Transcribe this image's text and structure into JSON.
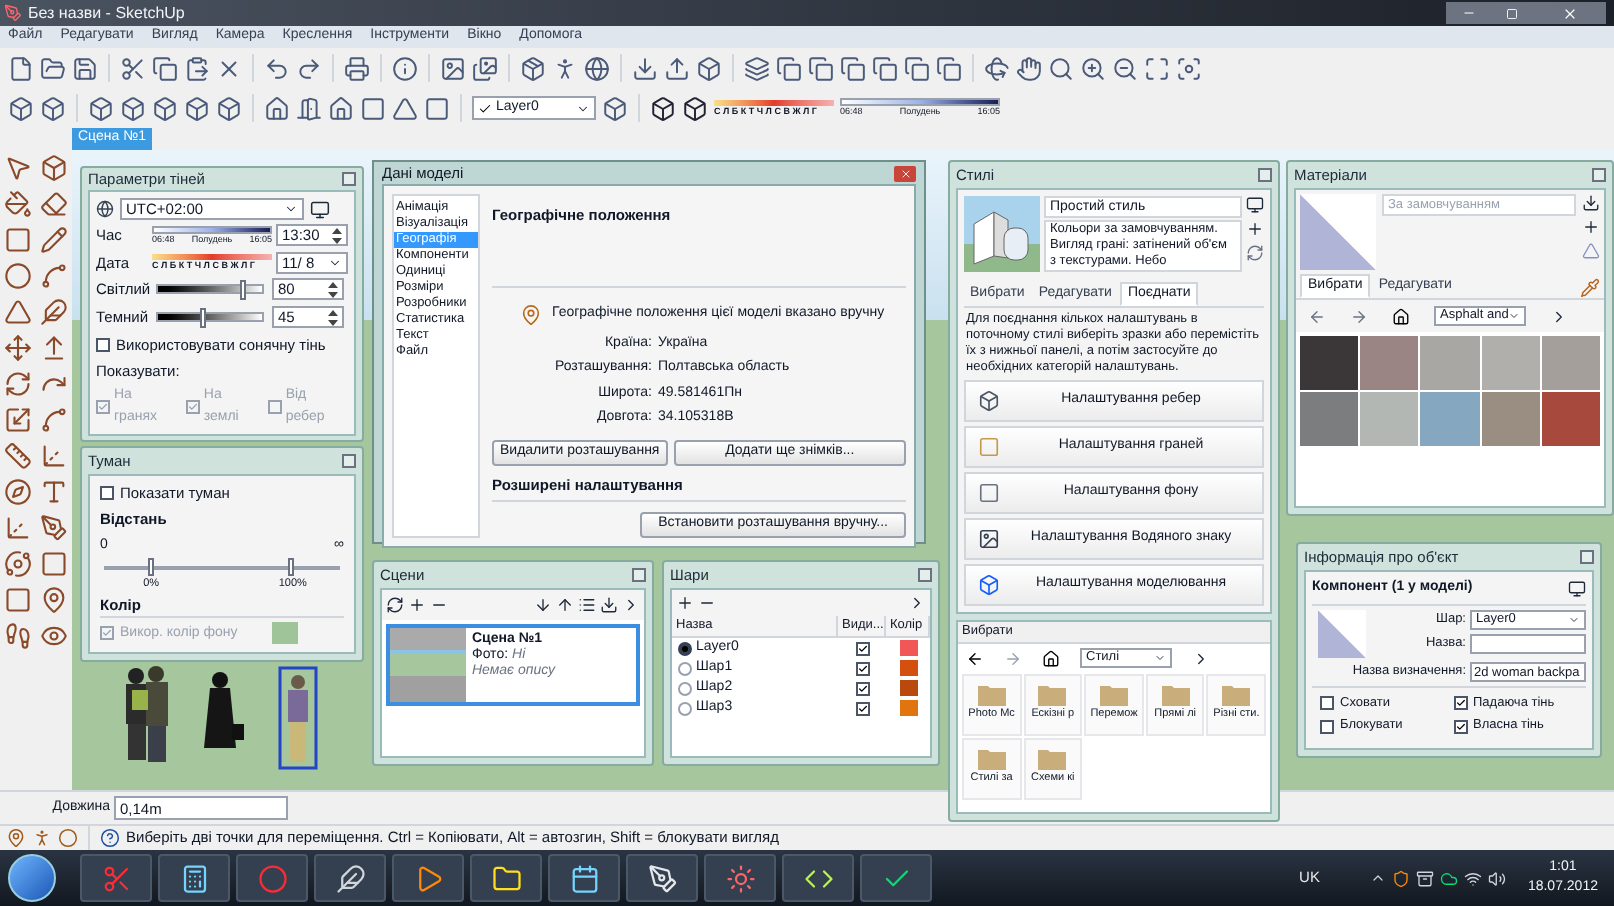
{
  "window": {
    "title": "Без назви - SketchUp"
  },
  "menu": [
    "Файл",
    "Редагувати",
    "Вигляд",
    "Камера",
    "Креслення",
    "Інструменти",
    "Вікно",
    "Допомога"
  ],
  "toolbar": {
    "layer": "Layer0",
    "months": "С Л Б К Т Ч Л С В Ж Л Г",
    "time_start": "06:48",
    "time_noon": "Полудень",
    "time_end": "16:05"
  },
  "scene_tabs": [
    {
      "label": "Сцена №1",
      "selected": true
    }
  ],
  "shadows": {
    "title": "Параметри тіней",
    "timezone": "UTC+02:00",
    "time_label": "Час",
    "time_start": "06:48",
    "time_noon": "Полудень",
    "time_end": "16:05",
    "time_value": "13:30",
    "date_label": "Дата",
    "months": "С Л Б К Т Ч Л С В Ж Л Г",
    "date_value": "11/ 8",
    "light": {
      "label": "Світлий",
      "level": 0.82,
      "value": "80"
    },
    "dark": {
      "label": "Темний",
      "level": 0.45,
      "value": "45"
    },
    "use_sun": {
      "label": "Використовувати сонячну тінь",
      "checked": false
    },
    "show_label": "Показувати:",
    "show_options": [
      {
        "label": "На гранях",
        "checked": true,
        "disabled": true
      },
      {
        "label": "На землі",
        "checked": true,
        "disabled": true
      },
      {
        "label": "Від ребер",
        "checked": false,
        "disabled": true
      }
    ]
  },
  "fog": {
    "title": "Туман",
    "show": {
      "label": "Показати туман",
      "checked": false
    },
    "distance_label": "Відстань",
    "start": "0",
    "end": "∞",
    "thumbs": [
      {
        "level": 0.2,
        "reading": "0%"
      },
      {
        "level": 0.8,
        "reading": "100%"
      }
    ],
    "color_label": "Колір",
    "use_bg": {
      "label": "Викор. колір фону",
      "checked": true,
      "disabled": true
    },
    "color": "#9fc49a"
  },
  "model_info": {
    "title": "Дані моделі",
    "nav": [
      {
        "label": "Анімація",
        "selected": false
      },
      {
        "label": "Візуалізація",
        "selected": false
      },
      {
        "label": "Географія",
        "selected": true
      },
      {
        "label": "Компоненти",
        "selected": false
      },
      {
        "label": "Одиниці",
        "selected": false
      },
      {
        "label": "Розміри",
        "selected": false
      },
      {
        "label": "Розробники",
        "selected": false
      },
      {
        "label": "Статистика",
        "selected": false
      },
      {
        "label": "Текст",
        "selected": false
      },
      {
        "label": "Файл",
        "selected": false
      }
    ],
    "heading": "Географічне положення",
    "notice": "Географічне положення цієї моделі вказано вручну",
    "fields": [
      {
        "label": "Країна:",
        "value": "Україна"
      },
      {
        "label": "Розташування:",
        "value": "Полтавська область"
      },
      {
        "label": "Широта:",
        "value": "49.581461Пн"
      },
      {
        "label": "Довгота:",
        "value": "34.105318В"
      }
    ],
    "buttons": [
      "Видалити розташування",
      "Додати ще знімків..."
    ],
    "advanced": "Розширені налаштування",
    "manual_button": "Встановити розташування вручну..."
  },
  "scenes": {
    "title": "Сцени",
    "items": [
      {
        "name": "Сцена №1",
        "photo_label": "Фото:",
        "photo_value": "Ні",
        "description": "Немає опису",
        "selected": true
      }
    ]
  },
  "layers": {
    "title": "Шари",
    "columns": [
      "Назва",
      "Види...",
      "Колір"
    ],
    "rows": [
      {
        "name": "Layer0",
        "selected": true,
        "visible": true,
        "color": "#f25757"
      },
      {
        "name": "Шар1",
        "selected": false,
        "visible": true,
        "color": "#d4500f"
      },
      {
        "name": "Шар2",
        "selected": false,
        "visible": true,
        "color": "#b9490c"
      },
      {
        "name": "Шар3",
        "selected": false,
        "visible": true,
        "color": "#e0740f"
      }
    ]
  },
  "styles": {
    "title": "Стилі",
    "name": "Простий стиль",
    "description": "Кольори за замовчуванням. Вигляд грані: затінений об'єм з текстурами. Небо",
    "tabs": [
      {
        "label": "Вибрати",
        "selected": false
      },
      {
        "label": "Редагувати",
        "selected": false
      },
      {
        "label": "Поєднати",
        "selected": true
      }
    ],
    "help": "Для поєднання кількох налаштувань в поточному стилі виберіть зразки або перемістіть їх з нижньої панелі, а потім застосуйте до необхідних категорій налаштувань.",
    "settings": [
      {
        "label": "Налаштування ребер",
        "kind": "edges"
      },
      {
        "label": "Налаштування граней",
        "kind": "faces"
      },
      {
        "label": "Налаштування фону",
        "kind": "background"
      },
      {
        "label": "Налаштування Водяного знаку",
        "kind": "watermark"
      },
      {
        "label": "Налаштування моделювання",
        "kind": "modeling"
      }
    ],
    "browser_label": "Вибрати",
    "collection": "Стилі",
    "folders": [
      "Photo Mc",
      "Ескізні р",
      "Перемож",
      "Прямі лі",
      "Різні сти.",
      "Стилі за",
      "Схеми кі"
    ]
  },
  "materials": {
    "title": "Матеріали",
    "name": "За замовчуванням",
    "tabs": [
      {
        "label": "Вибрати",
        "selected": true
      },
      {
        "label": "Редагувати",
        "selected": false
      }
    ],
    "collection": "Asphalt and",
    "swatches": [
      {
        "color": "#3b3738"
      },
      {
        "color": "#9a8584"
      },
      {
        "color": "#a9a7a4"
      },
      {
        "color": "#b0afab"
      },
      {
        "color": "#a59f9b"
      },
      {
        "color": "#7c7d7f"
      },
      {
        "color": "#b3b7b4"
      },
      {
        "color": "#85a8c0"
      },
      {
        "color": "#9a8e82"
      },
      {
        "color": "#a7493c"
      }
    ]
  },
  "entity": {
    "title": "Інформація про об'єкт",
    "heading": "Компонент (1 у моделі)",
    "layer_label": "Шар:",
    "layer": "Layer0",
    "name_label": "Назва:",
    "definition_label": "Назва визначення:",
    "definition": "2d woman backpa",
    "options": [
      {
        "label": "Сховати",
        "checked": false
      },
      {
        "label": "Падаюча тінь",
        "checked": true
      },
      {
        "label": "Блокувати",
        "checked": false
      },
      {
        "label": "Власна тінь",
        "checked": true
      }
    ]
  },
  "measurement": {
    "label": "Довжина",
    "value": "0,14m"
  },
  "status": "Виберіть дві точки для переміщення. Ctrl = Копіювати, Alt = автозгин, Shift = блокувати вигляд",
  "taskbar": {
    "language": "UK",
    "time": "1:01",
    "date": "18.07.2012"
  }
}
